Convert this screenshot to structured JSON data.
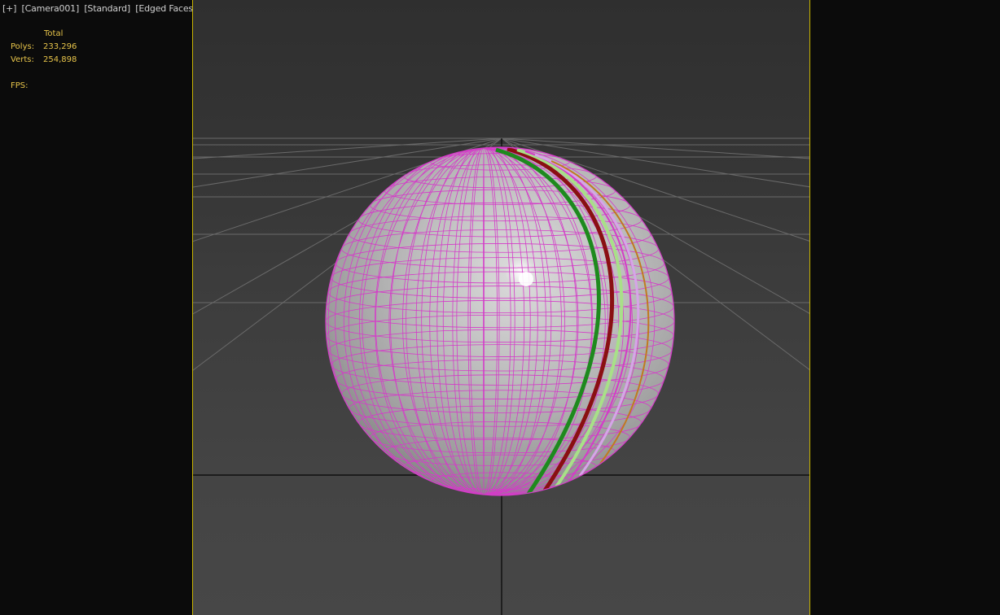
{
  "viewport": {
    "labels": {
      "plus": "[+]",
      "camera": "[Camera001]",
      "shading_mode": "[Standard]",
      "display_mode": "[Edged Faces]"
    },
    "stats": {
      "column_header": "Total",
      "polys_label": "Polys:",
      "polys_value": "233,296",
      "verts_label": "Verts:",
      "verts_value": "254,898",
      "fps_label": "FPS:"
    },
    "colors": {
      "border": "#c8b400",
      "stats_text": "#e7c44a",
      "wireframe": "#d43cc8",
      "seam_green": "#1e8a1e",
      "seam_red": "#8a0f12",
      "seam_light_green": "#a8e088",
      "seam_orange": "#c07a20"
    },
    "scene_object": {
      "type": "sphere",
      "icon": "sphere-mesh-icon"
    }
  }
}
